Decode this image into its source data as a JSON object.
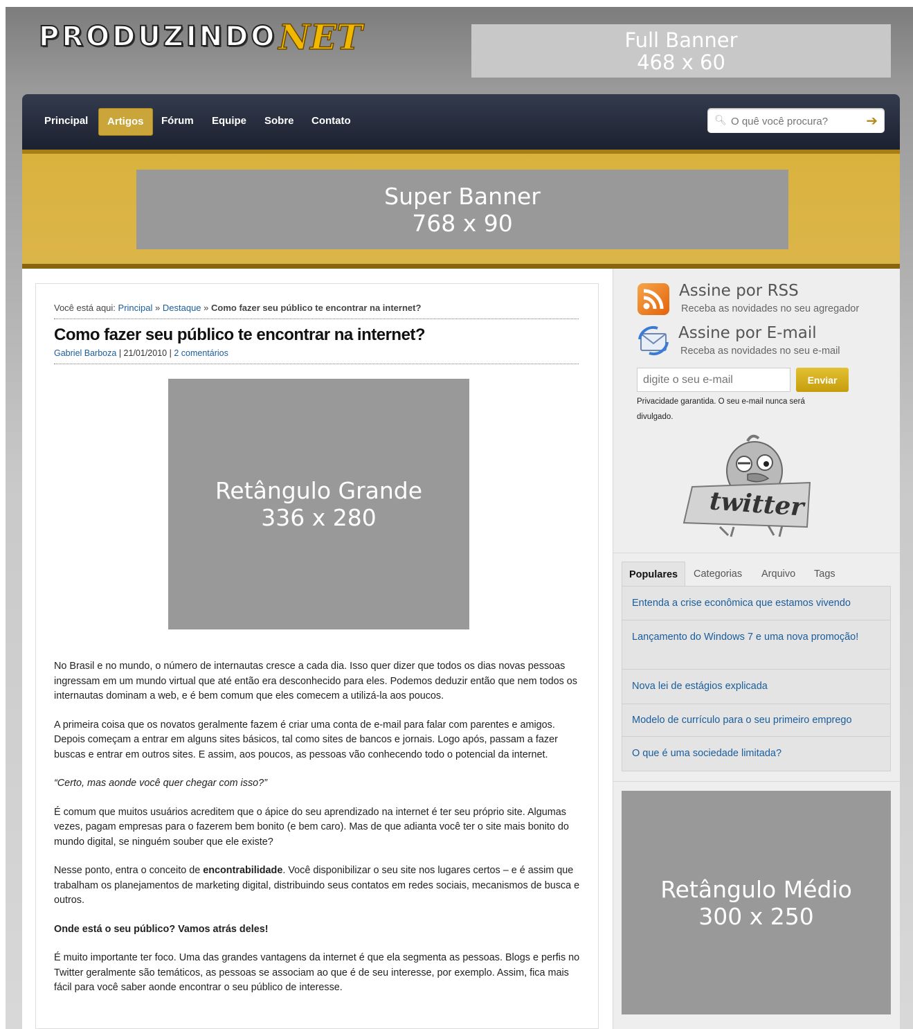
{
  "logo": {
    "part1": "PRODUZINDO",
    "part2": "NET"
  },
  "ads": {
    "full_banner": {
      "line1": "Full Banner",
      "line2": "468 x 60"
    },
    "super_banner": {
      "line1": "Super Banner",
      "line2": "768 x 90"
    },
    "ret_grande": {
      "line1": "Retângulo Grande",
      "line2": "336 x 280"
    },
    "ret_medio": {
      "line1": "Retângulo Médio",
      "line2": "300 x 250"
    }
  },
  "nav": {
    "items": [
      "Principal",
      "Artigos",
      "Fórum",
      "Equipe",
      "Sobre",
      "Contato"
    ],
    "active": "Artigos",
    "search_placeholder": "O quê você procura?"
  },
  "breadcrumb": {
    "prefix": "Você está aqui:",
    "home": "Principal",
    "sep": "»",
    "section": "Destaque",
    "current": "Como fazer seu público te encontrar na internet?"
  },
  "article": {
    "title": "Como fazer seu público te encontrar na internet?",
    "author": "Gabriel Barboza",
    "date": "21/01/2010",
    "comments": "2 comentários",
    "p1": "No Brasil e no mundo, o número de internautas cresce a cada dia. Isso quer dizer que todos os dias novas pessoas ingressam em um mundo virtual que até então era desconhecido para eles. Podemos deduzir então que nem todos os internautas dominam a web, e é bem comum que eles comecem a utilizá-la aos poucos.",
    "p2": "A primeira coisa que os novatos geralmente fazem é criar uma conta de e-mail para falar com parentes e amigos. Depois começam a entrar em alguns sites básicos, tal como sites de bancos e jornais. Logo após, passam a fazer buscas e entrar em outros sites. E assim, aos poucos, as pessoas vão conhecendo todo o potencial da internet.",
    "p3": "“Certo, mas aonde você quer chegar com isso?”",
    "p4": "É comum que muitos usuários acreditem que o ápice do seu aprendizado na internet é ter seu próprio site. Algumas vezes, pagam empresas para o fazerem bem bonito (e bem caro). Mas de que adianta você ter o site mais bonito do mundo digital, se ninguém souber que ele existe?",
    "p5_a": "Nesse ponto, entra o conceito de ",
    "p5_b": "encontrabilidade",
    "p5_c": ". Você disponibilizar o seu site nos lugares certos – e é assim que trabalham os planejamentos de marketing digital, distribuindo seus contatos em redes sociais, mecanismos de busca e outros.",
    "p6": "Onde está o seu público? Vamos atrás deles!",
    "p7": "É muito importante ter foco. Uma das grandes vantagens da internet é que ela segmenta as pessoas. Blogs e perfis no Twitter geralmente são temáticos, as pessoas se associam ao que é de seu interesse, por exemplo. Assim, fica mais fácil para você saber aonde encontrar o seu público de interesse."
  },
  "sidebar": {
    "rss_title": "Assine por RSS",
    "rss_desc": "Receba as novidades no seu agregador",
    "email_title": "Assine por E-mail",
    "email_desc": "Receba as novidades no seu e-mail",
    "email_placeholder": "digite o seu e-mail",
    "send_label": "Enviar",
    "privacy": "Privacidade garantida. O seu e-mail nunca será divulgado.",
    "twitter_label": "twitter",
    "tabs": [
      "Populares",
      "Categorias",
      "Arquivo",
      "Tags"
    ],
    "popular": [
      "Entenda a crise econômica que estamos vivendo",
      "Lançamento do Windows 7 e uma nova promoção!",
      "Nova lei de estágios explicada",
      "Modelo de currículo para o seu primeiro emprego",
      "O que é uma sociedade limitada?"
    ]
  },
  "colors": {
    "nav_bg": "#262c3c",
    "gold": "#d9b23e",
    "link": "#1a5d9b",
    "ad_gray": "#999999"
  }
}
